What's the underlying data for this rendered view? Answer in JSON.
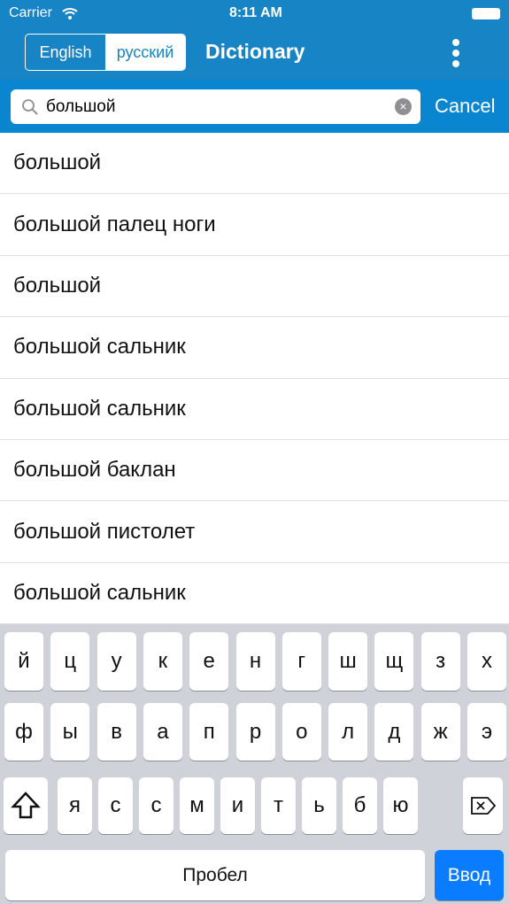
{
  "status": {
    "carrier": "Carrier",
    "time": "8:11 AM"
  },
  "header": {
    "segments": [
      "English",
      "русский"
    ],
    "selected": 1,
    "title": "Dictionary"
  },
  "search": {
    "value": "большой",
    "placeholder": "",
    "cancel_label": "Cancel"
  },
  "results": [
    "большой",
    "большой палец ноги",
    "большой",
    "большой сальник",
    "большой сальник",
    "большой баклан",
    "большой пистолет",
    "большой сальник"
  ],
  "keyboard": {
    "row1": [
      "й",
      "ц",
      "у",
      "к",
      "е",
      "н",
      "г",
      "ш",
      "щ",
      "з",
      "х"
    ],
    "row2": [
      "ф",
      "ы",
      "в",
      "а",
      "п",
      "р",
      "о",
      "л",
      "д",
      "ж",
      "э"
    ],
    "row3": [
      "я",
      "с",
      "с",
      "м",
      "и",
      "т",
      "ь",
      "б",
      "ю"
    ],
    "space_label": "Пробел",
    "return_label": "Ввод"
  },
  "colors": {
    "accent": "#1784c5",
    "return": "#0a7cff"
  }
}
